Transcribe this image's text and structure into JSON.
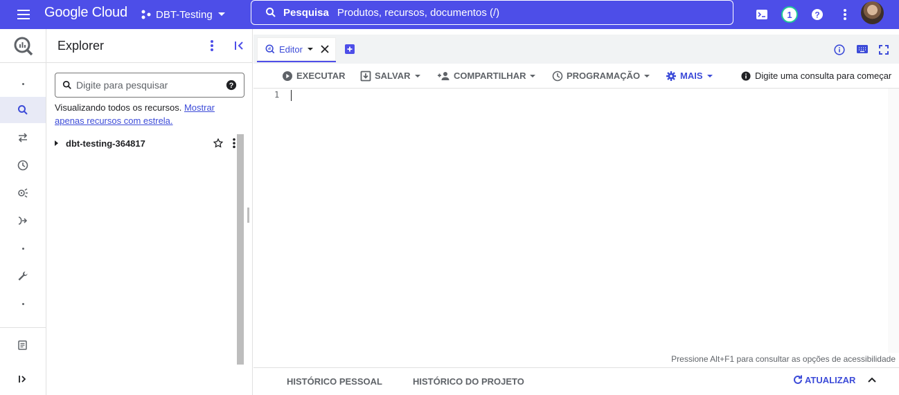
{
  "header": {
    "brand": "Google Cloud",
    "project": "DBT-Testing",
    "search_bold": "Pesquisa",
    "search_placeholder": "Produtos, recursos, documentos (/)",
    "notification_count": "1",
    "accent_color": "#4d4ee8"
  },
  "explorer": {
    "title": "Explorer",
    "search_placeholder": "Digite para pesquisar",
    "info_text": "Visualizando todos os recursos.",
    "info_link": "Mostrar apenas recursos com estrela.",
    "project_node": "dbt-testing-364817"
  },
  "editor": {
    "tab_label": "Editor",
    "toolbar": {
      "run": "EXECUTAR",
      "save": "SALVAR",
      "share": "COMPARTILHAR",
      "schedule": "PROGRAMAÇÃO",
      "more": "MAIS",
      "hint": "Digite uma consulta para começar"
    },
    "line_number": "1",
    "a11y_hint": "Pressione Alt+F1 para consultar as opções de acessibilidade"
  },
  "history": {
    "personal": "HISTÓRICO PESSOAL",
    "project": "HISTÓRICO DO PROJETO",
    "refresh": "ATUALIZAR"
  }
}
